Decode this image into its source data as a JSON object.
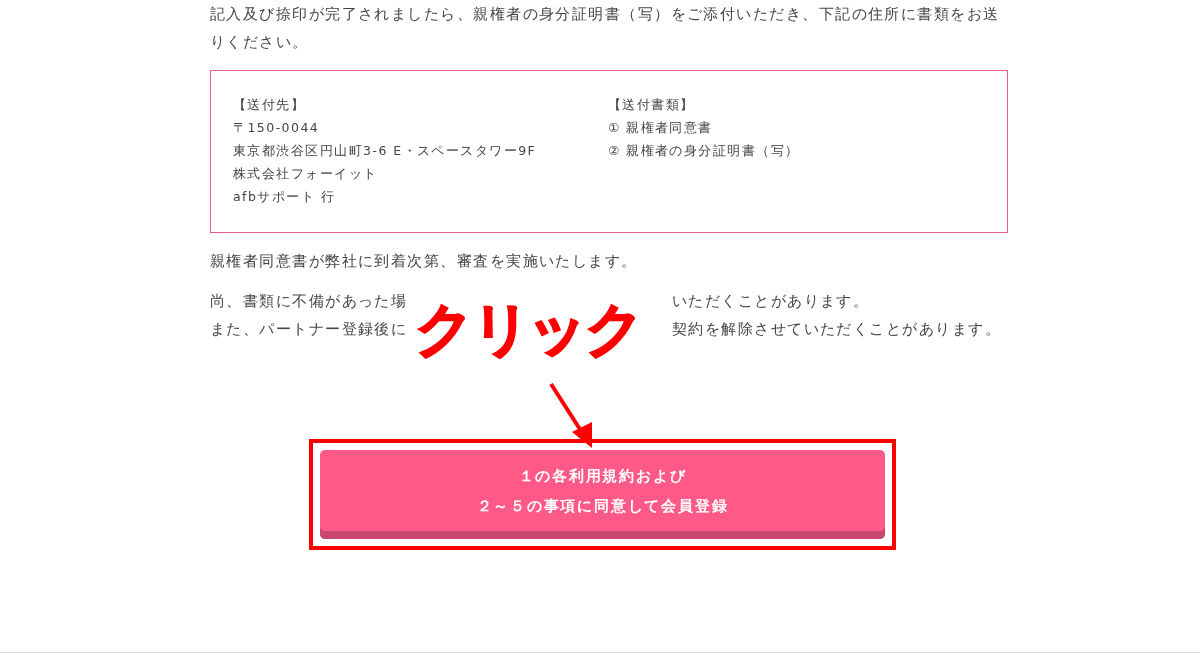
{
  "intro": "記入及び捺印が完了されましたら、親権者の身分証明書（写）をご添付いただき、下記の住所に書類をお送りください。",
  "address_box": {
    "columns": [
      {
        "heading": "【送付先】",
        "lines": [
          "〒150-0044",
          "東京都渋谷区円山町3-6 E・スペースタワー9F",
          "株式会社フォーイット",
          "afbサポート 行"
        ]
      },
      {
        "heading": "【送付書類】",
        "lines": [
          "① 親権者同意書",
          "② 親権者の身分証明書（写）"
        ]
      }
    ]
  },
  "note": "親権者同意書が弊社に到着次第、審査を実施いたします。",
  "warning_lines": [
    {
      "before": "尚、書類に不備があった場",
      "after": "いただくことがあります。"
    },
    {
      "before": "また、パートナー登録後に",
      "after": "契約を解除させていただくことがあります。"
    }
  ],
  "annotation": {
    "label": "クリック"
  },
  "submit_button": {
    "lines": [
      "１の各利用規約および",
      "２～５の事項に同意して会員登録"
    ],
    "highlighted": true
  }
}
